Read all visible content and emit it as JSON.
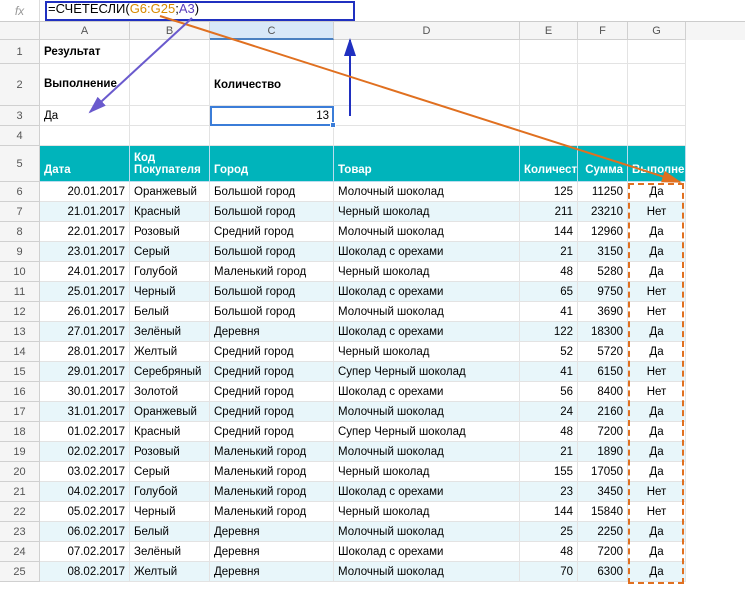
{
  "formula_bar": {
    "fx_label": "fx",
    "formula_prefix": "=",
    "formula_fn": "СЧЁТЕСЛИ",
    "formula_open": "(",
    "formula_range": "G6:G25",
    "formula_sep": ";",
    "formula_arg": "A3",
    "formula_close": ")"
  },
  "col_headers": [
    "",
    "A",
    "B",
    "C",
    "D",
    "E",
    "F",
    "G"
  ],
  "row_headers": [
    "1",
    "2",
    "3",
    "4",
    "5",
    "6",
    "7",
    "8",
    "9",
    "10",
    "11",
    "12",
    "13",
    "14",
    "15",
    "16",
    "17",
    "18",
    "19",
    "20",
    "21",
    "22",
    "23",
    "24",
    "25"
  ],
  "top_block": {
    "a1": "Результат",
    "a2": "Выполнение",
    "c2": "Количество",
    "a3": "Да",
    "c3": "13"
  },
  "data_headers": [
    "Дата",
    "Код Покупателя",
    "Город",
    "Товар",
    "Количество",
    "Сумма",
    "Выполнен"
  ],
  "rows": [
    {
      "d": "20.01.2017",
      "buyer": "Оранжевый",
      "city": "Большой город",
      "prod": "Молочный шоколад",
      "qty": "125",
      "sum": "11250",
      "done": "Да"
    },
    {
      "d": "21.01.2017",
      "buyer": "Красный",
      "city": "Большой город",
      "prod": "Черный шоколад",
      "qty": "211",
      "sum": "23210",
      "done": "Нет"
    },
    {
      "d": "22.01.2017",
      "buyer": "Розовый",
      "city": "Средний город",
      "prod": "Молочный шоколад",
      "qty": "144",
      "sum": "12960",
      "done": "Да"
    },
    {
      "d": "23.01.2017",
      "buyer": "Серый",
      "city": "Большой город",
      "prod": "Шоколад с орехами",
      "qty": "21",
      "sum": "3150",
      "done": "Да"
    },
    {
      "d": "24.01.2017",
      "buyer": "Голубой",
      "city": "Маленький город",
      "prod": "Черный шоколад",
      "qty": "48",
      "sum": "5280",
      "done": "Да"
    },
    {
      "d": "25.01.2017",
      "buyer": "Черный",
      "city": "Большой город",
      "prod": "Шоколад с орехами",
      "qty": "65",
      "sum": "9750",
      "done": "Нет"
    },
    {
      "d": "26.01.2017",
      "buyer": "Белый",
      "city": "Большой город",
      "prod": "Молочный шоколад",
      "qty": "41",
      "sum": "3690",
      "done": "Нет"
    },
    {
      "d": "27.01.2017",
      "buyer": "Зелёный",
      "city": "Деревня",
      "prod": "Шоколад с орехами",
      "qty": "122",
      "sum": "18300",
      "done": "Да"
    },
    {
      "d": "28.01.2017",
      "buyer": "Желтый",
      "city": "Средний город",
      "prod": "Черный шоколад",
      "qty": "52",
      "sum": "5720",
      "done": "Да"
    },
    {
      "d": "29.01.2017",
      "buyer": "Серебряный",
      "city": "Средний город",
      "prod": "Супер Черный шоколад",
      "qty": "41",
      "sum": "6150",
      "done": "Нет"
    },
    {
      "d": "30.01.2017",
      "buyer": "Золотой",
      "city": "Средний город",
      "prod": "Шоколад с орехами",
      "qty": "56",
      "sum": "8400",
      "done": "Нет"
    },
    {
      "d": "31.01.2017",
      "buyer": "Оранжевый",
      "city": "Средний город",
      "prod": "Молочный шоколад",
      "qty": "24",
      "sum": "2160",
      "done": "Да"
    },
    {
      "d": "01.02.2017",
      "buyer": "Красный",
      "city": "Средний город",
      "prod": "Супер Черный шоколад",
      "qty": "48",
      "sum": "7200",
      "done": "Да"
    },
    {
      "d": "02.02.2017",
      "buyer": "Розовый",
      "city": "Маленький город",
      "prod": "Молочный шоколад",
      "qty": "21",
      "sum": "1890",
      "done": "Да"
    },
    {
      "d": "03.02.2017",
      "buyer": "Серый",
      "city": "Маленький город",
      "prod": "Черный шоколад",
      "qty": "155",
      "sum": "17050",
      "done": "Да"
    },
    {
      "d": "04.02.2017",
      "buyer": "Голубой",
      "city": "Маленький город",
      "prod": "Шоколад с орехами",
      "qty": "23",
      "sum": "3450",
      "done": "Нет"
    },
    {
      "d": "05.02.2017",
      "buyer": "Черный",
      "city": "Маленький город",
      "prod": "Черный шоколад",
      "qty": "144",
      "sum": "15840",
      "done": "Нет"
    },
    {
      "d": "06.02.2017",
      "buyer": "Белый",
      "city": "Деревня",
      "prod": "Молочный шоколад",
      "qty": "25",
      "sum": "2250",
      "done": "Да"
    },
    {
      "d": "07.02.2017",
      "buyer": "Зелёный",
      "city": "Деревня",
      "prod": "Шоколад с орехами",
      "qty": "48",
      "sum": "7200",
      "done": "Да"
    },
    {
      "d": "08.02.2017",
      "buyer": "Желтый",
      "city": "Деревня",
      "prod": "Молочный шоколад",
      "qty": "70",
      "sum": "6300",
      "done": "Да"
    }
  ]
}
